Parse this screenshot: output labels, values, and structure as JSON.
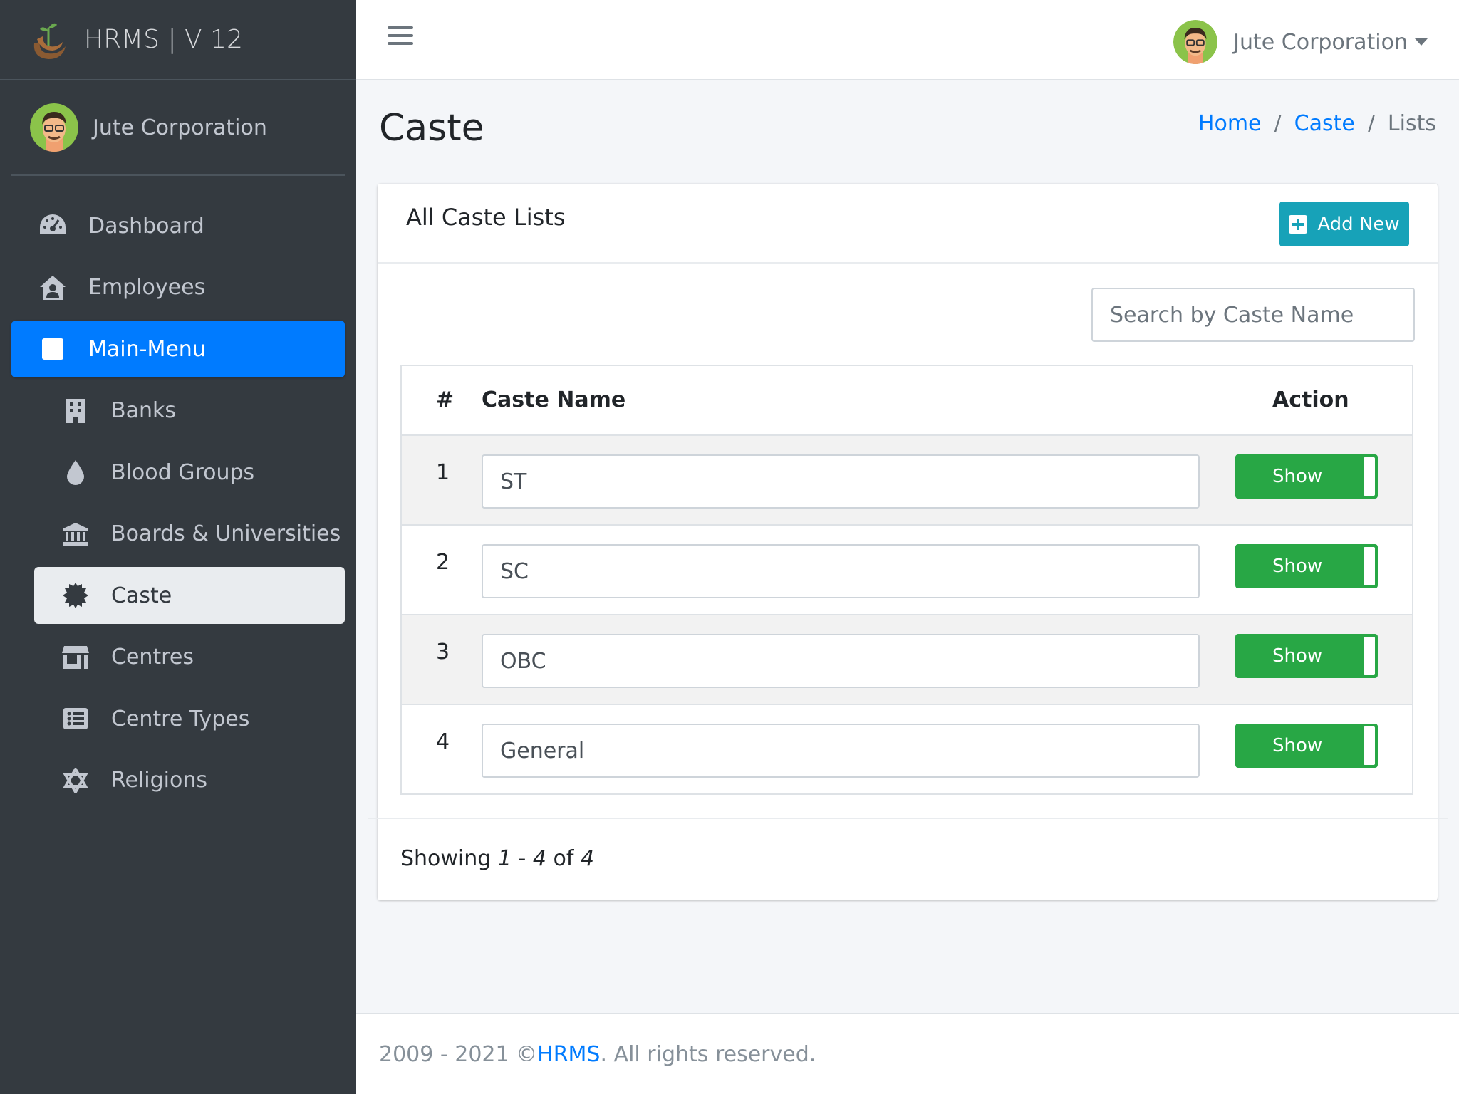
{
  "brand": {
    "title": "HRMS | V 12"
  },
  "user": {
    "name": "Jute Corporation"
  },
  "sidebar": {
    "items": [
      {
        "label": "Dashboard",
        "icon": "tachometer-icon"
      },
      {
        "label": "Employees",
        "icon": "user-house-icon"
      },
      {
        "label": "Main-Menu",
        "icon": "square-icon",
        "active": true
      },
      {
        "label": "Banks",
        "icon": "building-icon"
      },
      {
        "label": "Blood Groups",
        "icon": "tint-icon"
      },
      {
        "label": "Boards & Universities",
        "icon": "university-icon"
      },
      {
        "label": "Caste",
        "icon": "certificate-icon",
        "active": true
      },
      {
        "label": "Centres",
        "icon": "store-icon"
      },
      {
        "label": "Centre Types",
        "icon": "list-alt-icon"
      },
      {
        "label": "Religions",
        "icon": "star-of-david-icon"
      }
    ]
  },
  "navbar": {
    "user_name": "Jute Corporation"
  },
  "page": {
    "title": "Caste",
    "breadcrumb": [
      "Home",
      "Caste",
      "Lists"
    ]
  },
  "card": {
    "title": "All Caste Lists",
    "add_button": "Add New",
    "search_placeholder": "Search by Caste Name",
    "table": {
      "headers": [
        "#",
        "Caste Name",
        "Action"
      ],
      "rows": [
        {
          "num": "1",
          "name": "ST",
          "action": "Show"
        },
        {
          "num": "2",
          "name": "SC",
          "action": "Show"
        },
        {
          "num": "3",
          "name": "OBC",
          "action": "Show"
        },
        {
          "num": "4",
          "name": "General",
          "action": "Show"
        }
      ]
    },
    "showing": {
      "prefix": "Showing ",
      "from": "1",
      "dash": " - ",
      "to": "4",
      "of": " of ",
      "total": "4"
    }
  },
  "footer": {
    "years": "2009 - 2021 © ",
    "link": "HRMS",
    "suffix": ". All rights reserved."
  },
  "colors": {
    "sidebar_bg": "#343a40",
    "primary": "#007bff",
    "info": "#17a2b8",
    "success": "#28a745"
  }
}
